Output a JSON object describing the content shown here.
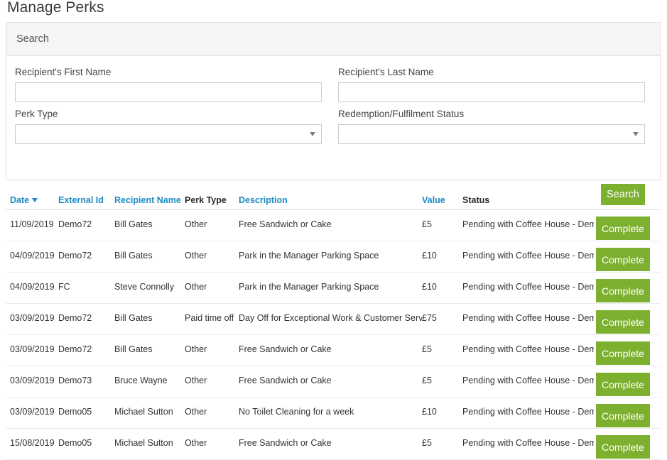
{
  "page": {
    "title": "Manage Perks"
  },
  "search_panel": {
    "heading": "Search",
    "fields": {
      "first_name": {
        "label": "Recipient's First Name",
        "value": "",
        "placeholder": ""
      },
      "last_name": {
        "label": "Recipient's Last Name",
        "value": "",
        "placeholder": ""
      },
      "perk_type": {
        "label": "Perk Type",
        "selected": "",
        "caret_icon": "chevron-down-icon"
      },
      "status": {
        "label": "Redemption/Fulfilment Status",
        "selected": "",
        "caret_icon": "chevron-down-icon"
      }
    },
    "search_button": "Search"
  },
  "table": {
    "columns": [
      {
        "key": "date",
        "label": "Date",
        "link": true,
        "sort": "desc",
        "sort_icon": "chevron-down-icon"
      },
      {
        "key": "extid",
        "label": "External Id",
        "link": true,
        "sort": "none"
      },
      {
        "key": "recip",
        "label": "Recipient Name",
        "link": true,
        "sort": "none"
      },
      {
        "key": "perk",
        "label": "Perk Type",
        "link": false,
        "sort": "none"
      },
      {
        "key": "desc",
        "label": "Description",
        "link": true,
        "sort": "none"
      },
      {
        "key": "value",
        "label": "Value",
        "link": true,
        "sort": "none"
      },
      {
        "key": "status",
        "label": "Status",
        "link": false,
        "sort": "none"
      }
    ],
    "action_label": "Complete",
    "rows": [
      {
        "date": "11/09/2019",
        "extid": "Demo72",
        "recip": "Bill Gates",
        "perk": "Other",
        "desc": "Free Sandwich or Cake",
        "value": "£5",
        "status": "Pending with Coffee House - Demo",
        "action": "Complete"
      },
      {
        "date": "04/09/2019",
        "extid": "Demo72",
        "recip": "Bill Gates",
        "perk": "Other",
        "desc": "Park in the Manager Parking Space",
        "value": "£10",
        "status": "Pending with Coffee House - Demo",
        "action": "Complete"
      },
      {
        "date": "04/09/2019",
        "extid": "FC",
        "recip": "Steve Connolly",
        "perk": "Other",
        "desc": "Park in the Manager Parking Space",
        "value": "£10",
        "status": "Pending with Coffee House - Demo",
        "action": "Complete"
      },
      {
        "date": "03/09/2019",
        "extid": "Demo72",
        "recip": "Bill Gates",
        "perk": "Paid time off",
        "desc": "Day Off for Exceptional Work & Customer Service",
        "value": "£75",
        "status": "Pending with Coffee House - Demo",
        "action": "Complete"
      },
      {
        "date": "03/09/2019",
        "extid": "Demo72",
        "recip": "Bill Gates",
        "perk": "Other",
        "desc": "Free Sandwich or Cake",
        "value": "£5",
        "status": "Pending with Coffee House - Demo",
        "action": "Complete"
      },
      {
        "date": "03/09/2019",
        "extid": "Demo73",
        "recip": "Bruce Wayne",
        "perk": "Other",
        "desc": "Free Sandwich or Cake",
        "value": "£5",
        "status": "Pending with Coffee House - Demo",
        "action": "Complete"
      },
      {
        "date": "03/09/2019",
        "extid": "Demo05",
        "recip": "Michael Sutton",
        "perk": "Other",
        "desc": "No Toilet Cleaning for a week",
        "value": "£10",
        "status": "Pending with Coffee House - Demo",
        "action": "Complete"
      },
      {
        "date": "15/08/2019",
        "extid": "Demo05",
        "recip": "Michael Sutton",
        "perk": "Other",
        "desc": "Free Sandwich or Cake",
        "value": "£5",
        "status": "Pending with Coffee House - Demo",
        "action": "Complete"
      }
    ]
  },
  "colors": {
    "accent_green": "#7cb02e",
    "link_blue": "#1a8bc4",
    "panel_heading_bg": "#f5f5f5",
    "border": "#e2e2e2",
    "row_border": "#ececec",
    "text": "#333333"
  }
}
